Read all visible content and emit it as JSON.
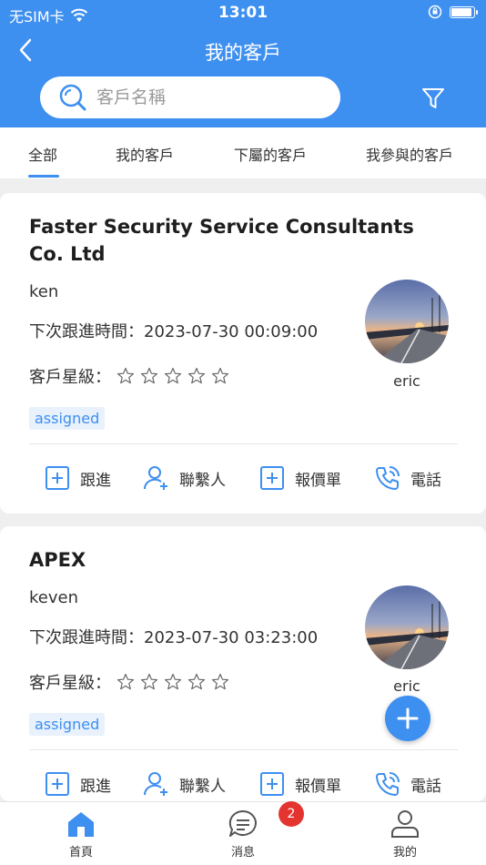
{
  "status_bar": {
    "carrier": "无SIM卡",
    "time": "13:01"
  },
  "header": {
    "title": "我的客戶"
  },
  "search": {
    "placeholder": "客戶名稱"
  },
  "tabs": [
    {
      "label": "全部",
      "active": true
    },
    {
      "label": "我的客戶"
    },
    {
      "label": "下屬的客戶"
    },
    {
      "label": "我參與的客戶"
    }
  ],
  "rating_label": "客戶星級：",
  "next_followup_label": "下次跟進時間：",
  "customers": [
    {
      "name": "Faster Security Service Consultants Co. Ltd",
      "contact": "ken",
      "next_followup": "2023-07-30 00:09:00",
      "stars": 0,
      "tag": "assigned",
      "owner": "eric"
    },
    {
      "name": "APEX",
      "contact": "keven",
      "next_followup": "2023-07-30 03:23:00",
      "stars": 0,
      "tag": "assigned",
      "owner": "eric"
    }
  ],
  "actions": {
    "follow_up": "跟進",
    "contacts": "聯繫人",
    "quote": "報價單",
    "phone": "電話"
  },
  "tabbar": {
    "home": "首頁",
    "messages": "消息",
    "messages_badge": "2",
    "me": "我的"
  },
  "colors": {
    "primary": "#3d8ff0",
    "badge": "#e4342f",
    "tag_bg": "#e8f1fc"
  }
}
